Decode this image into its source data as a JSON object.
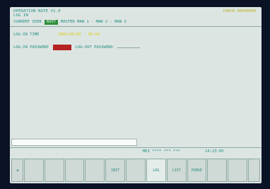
{
  "header": {
    "title_line1": "OPERATION NOTE V1.0",
    "title_line2": "LOG IN",
    "serial": "CHECK 00000000"
  },
  "current_user": {
    "label": "CURRENT USER",
    "value": "ROOT",
    "levels": "MASTER MAN 1 · MAN 2 · MAN 3"
  },
  "login_time": {
    "label": "LOG-IN TIME",
    "value": "2000/00/00 · 00:00"
  },
  "passwords": {
    "login_label": "LOG-IN PASSWORD",
    "logout_label": "LOG-OUT PASSWORD"
  },
  "status_bar": {
    "mode": "MDI  **** *** ***",
    "time": "14:23:05"
  },
  "softkeys": [
    "◀",
    "",
    "",
    "",
    "",
    "INIT",
    "",
    "LOG",
    "LIST",
    "PURGE",
    "",
    "",
    ""
  ]
}
